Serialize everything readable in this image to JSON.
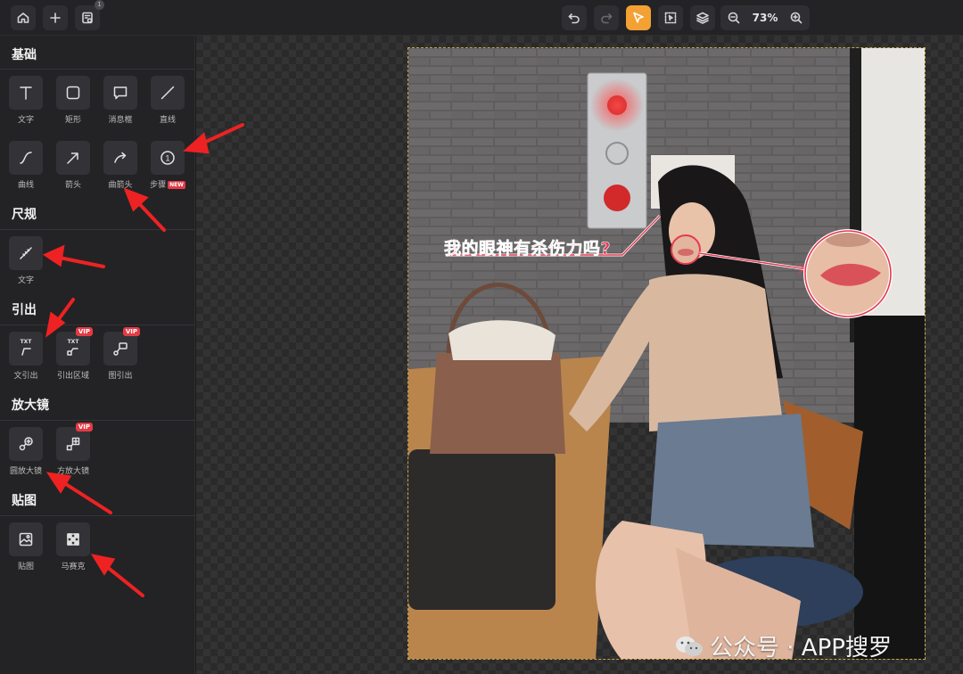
{
  "topbar": {
    "left_icons": [
      "home-icon",
      "plus-icon",
      "history-icon"
    ],
    "history_badge": "1",
    "center_icons": [
      "undo-icon",
      "redo-icon",
      "select-pointer-icon",
      "crop-select-icon",
      "layers-icon"
    ],
    "zoom_value": "73%",
    "accent_color": "#f3a133"
  },
  "sidebar": {
    "sections": {
      "basic": {
        "title": "基础",
        "tools": [
          {
            "label": "文字",
            "icon": "text-icon"
          },
          {
            "label": "矩形",
            "icon": "rectangle-icon"
          },
          {
            "label": "消息框",
            "icon": "speech-bubble-icon"
          },
          {
            "label": "直线",
            "icon": "line-icon"
          },
          {
            "label": "曲线",
            "icon": "curve-icon"
          },
          {
            "label": "箭头",
            "icon": "arrow-icon"
          },
          {
            "label": "曲箭头",
            "icon": "curved-arrow-icon"
          },
          {
            "label": "步骤",
            "icon": "step-number-icon",
            "step_glyph": "1",
            "badge": "NEW"
          }
        ]
      },
      "ruler": {
        "title": "尺规",
        "tools": [
          {
            "label": "文字",
            "icon": "ruler-icon"
          }
        ]
      },
      "callout": {
        "title": "引出",
        "tools": [
          {
            "label": "文引出",
            "icon": "text-callout-icon",
            "mini": "TXT"
          },
          {
            "label": "引出区域",
            "icon": "area-callout-icon",
            "mini": "TXT",
            "badge": "VIP"
          },
          {
            "label": "图引出",
            "icon": "image-callout-icon",
            "badge": "VIP"
          }
        ]
      },
      "magnifier": {
        "title": "放大镜",
        "tools": [
          {
            "label": "圆放大镜",
            "icon": "circle-magnifier-icon"
          },
          {
            "label": "方放大镜",
            "icon": "square-magnifier-icon",
            "badge": "VIP"
          }
        ]
      },
      "sticker": {
        "title": "贴图",
        "tools": [
          {
            "label": "贴图",
            "icon": "image-sticker-icon"
          },
          {
            "label": "马赛克",
            "icon": "mosaic-icon"
          }
        ]
      }
    }
  },
  "canvas": {
    "annotation_text": "我的眼神有杀伤力吗?",
    "watermark_text": "公众号 · APP搜罗",
    "annotation_color": "#e23a52"
  }
}
